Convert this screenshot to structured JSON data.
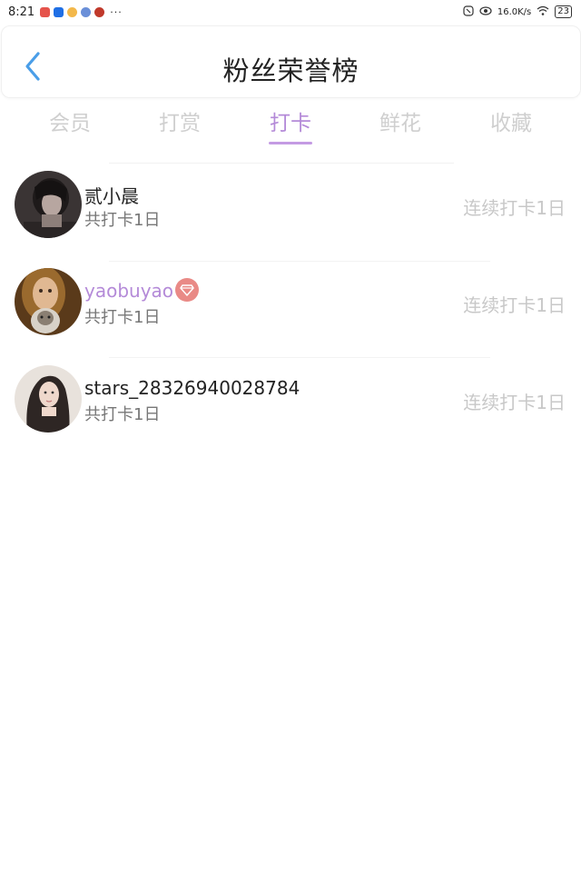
{
  "status_bar": {
    "time": "8:21",
    "dots": "···",
    "network_speed": "16.0K/s",
    "battery": "23",
    "app_icon_colors": [
      "#e5534b",
      "#1f6fe5",
      "#f3b84a",
      "#6a8fd8",
      "#c0392b"
    ]
  },
  "header": {
    "title": "粉丝荣誉榜"
  },
  "tabs": [
    {
      "label": "会员"
    },
    {
      "label": "打赏"
    },
    {
      "label": "打卡"
    },
    {
      "label": "鲜花"
    },
    {
      "label": "收藏"
    }
  ],
  "active_tab": "打卡",
  "colors": {
    "accent": "#b48ad8",
    "back_arrow": "#4a9ee8",
    "vip_badge": "#e98a86"
  },
  "list": [
    {
      "name": "贰小晨",
      "sub": "共打卡1日",
      "streak": "连续打卡1日",
      "vip": false
    },
    {
      "name": "yaobuyao",
      "sub": "共打卡1日",
      "streak": "连续打卡1日",
      "vip": true
    },
    {
      "name": "stars_28326940028784",
      "sub": "共打卡1日",
      "streak": "连续打卡1日",
      "vip": false
    }
  ]
}
